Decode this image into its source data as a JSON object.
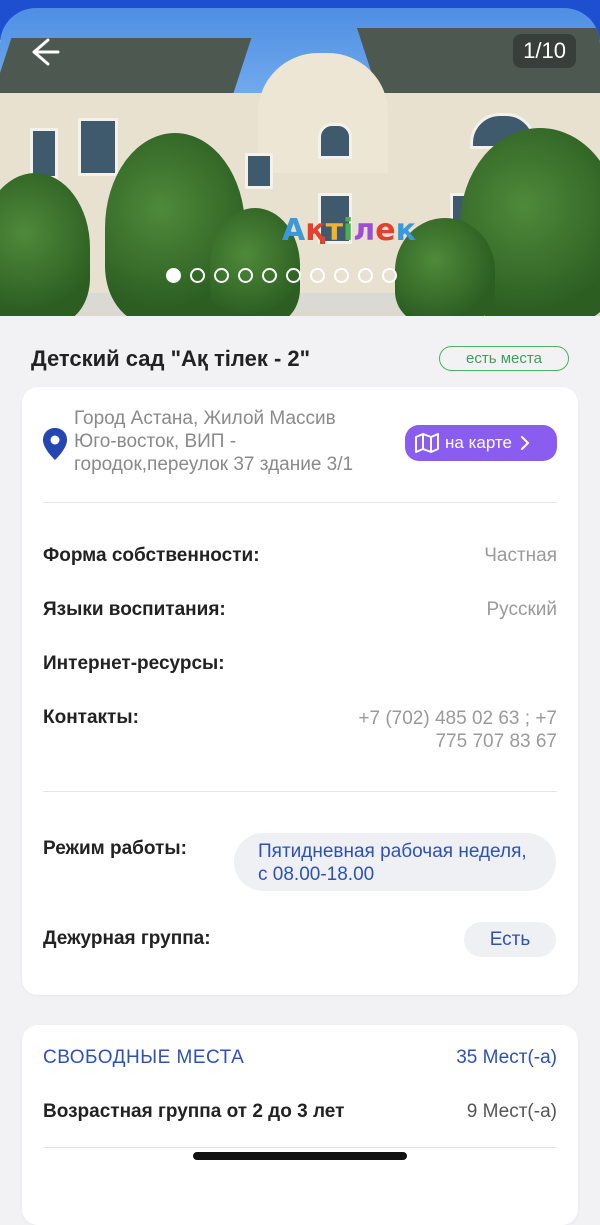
{
  "gallery": {
    "counter": "1/10",
    "dots_total": 10,
    "active_index": 0,
    "sign_text": "Ақтілек"
  },
  "header": {
    "title": "Детский сад \"Ақ тілек - 2\"",
    "availability_badge": "есть места"
  },
  "address": {
    "lines": [
      "Город Астана, Жилой Массив",
      "Юго-восток, ВИП -",
      "городок,переулок 37 здание 3/1"
    ],
    "map_button": "на карте"
  },
  "details": {
    "ownership_label": "Форма собственности:",
    "ownership_value": "Частная",
    "languages_label": "Языки воспитания:",
    "languages_value": "Русский",
    "internet_label": "Интернет-ресурсы:",
    "contacts_label": "Контакты:",
    "contacts_value": "+7 (702) 485 02 63 ; +7 775 707 83 67",
    "mode_label": "Режим работы:",
    "mode_value": "Пятидневная рабочая неделя, с 08.00-18.00",
    "duty_label": "Дежурная группа:",
    "duty_value": "Есть"
  },
  "places": {
    "heading": "СВОБОДНЫЕ МЕСТА",
    "total": "35 Мест(-а)",
    "age_group": "Возрастная группа от 2 до 3 лет",
    "age_group_count": "9 Мест(-а)"
  },
  "colors": {
    "brand_blue": "#1f4fd1",
    "accent_purple": "#8a5cf0",
    "green_badge": "#3c9e5a",
    "link_blue": "#2d51b8"
  }
}
